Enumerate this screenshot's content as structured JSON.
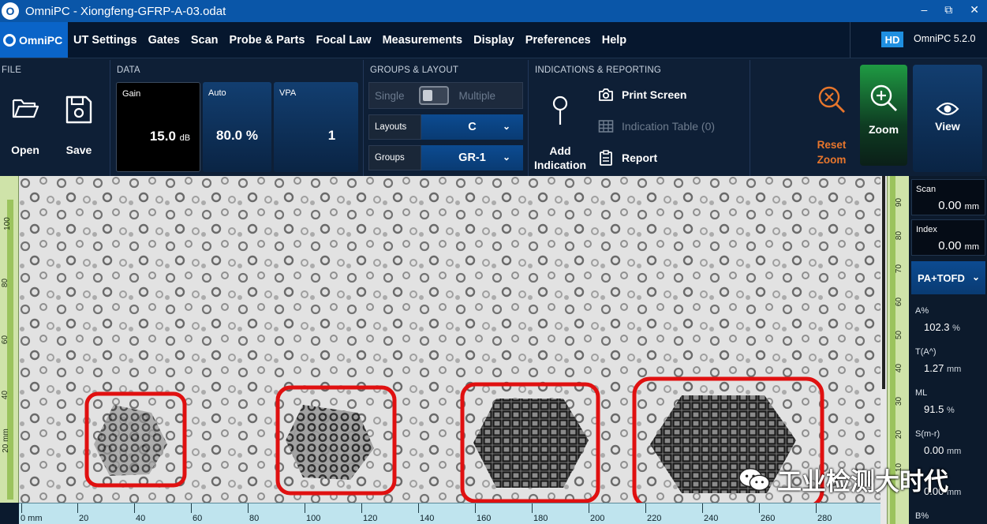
{
  "window": {
    "title": "OmniPC - Xiongfeng-GFRP-A-03.odat",
    "logo_letter": "O"
  },
  "menu": {
    "brand": "OmniPC",
    "items": [
      "UT Settings",
      "Gates",
      "Scan",
      "Probe & Parts",
      "Focal Law",
      "Measurements",
      "Display",
      "Preferences",
      "Help"
    ],
    "hd_badge": "HD",
    "version": "OmniPC 5.2.0"
  },
  "ribbon": {
    "file": {
      "label": "FILE",
      "open": "Open",
      "save": "Save"
    },
    "data": {
      "label": "DATA",
      "gain": {
        "label": "Gain",
        "value": "15.0",
        "unit": "dB"
      },
      "auto": {
        "label": "Auto",
        "value": "80.0 %"
      },
      "vpa": {
        "label": "VPA",
        "value": "1"
      }
    },
    "groups": {
      "label": "GROUPS & LAYOUT",
      "single": "Single",
      "multiple": "Multiple",
      "layouts_label": "Layouts",
      "layouts_value": "C",
      "groups_label": "Groups",
      "groups_value": "GR-1"
    },
    "indications": {
      "label": "INDICATIONS & REPORTING",
      "add_line1": "Add",
      "add_line2": "Indication",
      "print_screen": "Print Screen",
      "indication_table": "Indication Table (0)",
      "report": "Report"
    },
    "reset_zoom_line1": "Reset",
    "reset_zoom_line2": "Zoom",
    "zoom": "Zoom",
    "view": "View"
  },
  "left_ruler_ticks": [
    "100",
    "80",
    "60",
    "40",
    "20 mm"
  ],
  "bottom_ruler_ticks": [
    "0 mm",
    "20",
    "40",
    "60",
    "80",
    "100",
    "120",
    "140",
    "160",
    "180",
    "200",
    "220",
    "240",
    "260",
    "280"
  ],
  "right_ruler_ticks": [
    "90",
    "80",
    "70",
    "60",
    "50",
    "40",
    "30",
    "20",
    "10"
  ],
  "readouts": {
    "scan": {
      "label": "Scan",
      "value": "0.00",
      "unit": "mm"
    },
    "index": {
      "label": "Index",
      "value": "0.00",
      "unit": "mm"
    },
    "mode": "PA+TOFD",
    "measures": [
      {
        "label": "A%",
        "value": "102.3",
        "unit": "%"
      },
      {
        "label": "T(A^)",
        "value": "1.27",
        "unit": "mm"
      },
      {
        "label": "ML",
        "value": "91.5",
        "unit": "%"
      },
      {
        "label": "S(m-r)",
        "value": "0.00",
        "unit": "mm"
      },
      {
        "label": "",
        "value": "0.00",
        "unit": "mm"
      },
      {
        "label": "B%",
        "value": "",
        "unit": ""
      }
    ]
  },
  "watermark": "工业检测大时代",
  "colors": {
    "accent": "#0a64c8",
    "highlight": "#e01010",
    "reset": "#e8762c",
    "zoom": "#1f9b43"
  }
}
